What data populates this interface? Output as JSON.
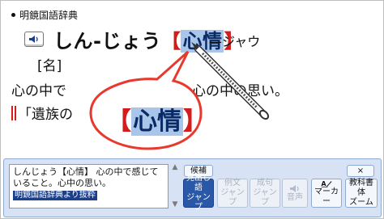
{
  "dictionary": {
    "name": "明鏡国語辞典"
  },
  "entry": {
    "reading": "しん-じょう",
    "bracket_open": "【",
    "headword_kanji": "心情",
    "bracket_close": "】",
    "pronunciation": "—ジャウ",
    "part_of_speech": "[名]",
    "definition_before": "心の中で",
    "definition_after": "こと。心の中の思い。",
    "example": "「遺族の"
  },
  "zoom_popup": {
    "open": "【",
    "text": "心情",
    "close": "】"
  },
  "memo": {
    "text": "しんじょう【心情】 心の中で感じていること。心中の思い。",
    "source": "明鏡国語辞典より抜粋"
  },
  "buttons": {
    "kouho": "候補",
    "midashigo_jump": [
      "見出し語",
      "ジャンプ"
    ],
    "reibun_jump": [
      "例文",
      "ジャンプ"
    ],
    "seiku_jump": [
      "成句",
      "ジャンプ"
    ],
    "onsei": "音声",
    "marker": "マーカー",
    "kyoukasho": [
      "教科書体",
      "ズーム"
    ],
    "close": "×"
  },
  "icons": {
    "speaker": "speaker-icon",
    "marker": "marker-pen-icon"
  },
  "colors": {
    "accent": "#2a58a8",
    "bracket": "#d31d1d",
    "highlight": "#a9c6ea",
    "zoom_circle": "#e8392c"
  }
}
